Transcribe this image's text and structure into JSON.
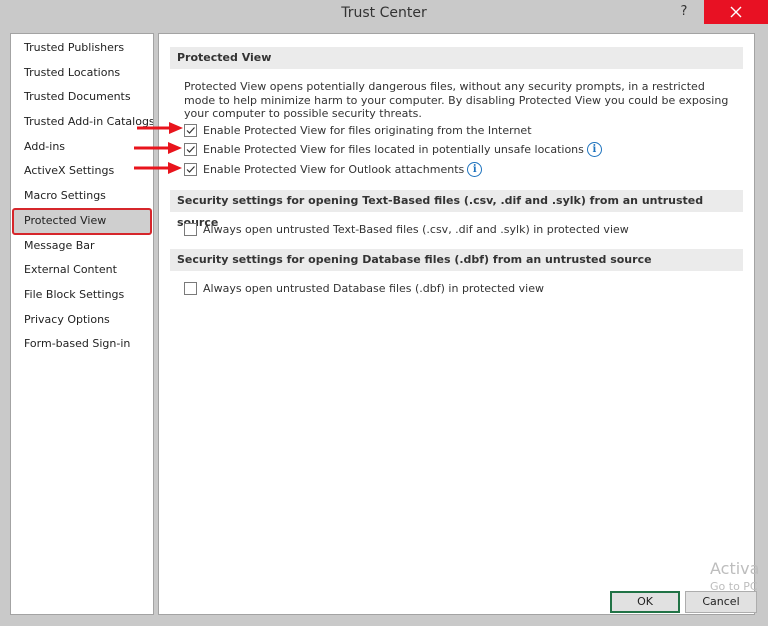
{
  "window": {
    "title": "Trust Center",
    "help_label": "?"
  },
  "sidebar": {
    "items": [
      {
        "label": "Trusted Publishers"
      },
      {
        "label": "Trusted Locations"
      },
      {
        "label": "Trusted Documents"
      },
      {
        "label": "Trusted Add-in Catalogs"
      },
      {
        "label": "Add-ins"
      },
      {
        "label": "ActiveX Settings"
      },
      {
        "label": "Macro Settings"
      },
      {
        "label": "Protected View",
        "selected": true
      },
      {
        "label": "Message Bar"
      },
      {
        "label": "External Content"
      },
      {
        "label": "File Block Settings"
      },
      {
        "label": "Privacy Options"
      },
      {
        "label": "Form-based Sign-in"
      }
    ]
  },
  "main": {
    "protected_view": {
      "header": "Protected View",
      "description": "Protected View opens potentially dangerous files, without any security prompts, in a restricted mode to help minimize harm to your computer. By disabling Protected View you could be exposing your computer to possible security threats.",
      "options": [
        {
          "label": "Enable Protected View for files originating from the Internet",
          "checked": true
        },
        {
          "label": "Enable Protected View for files located in potentially unsafe locations",
          "checked": true
        },
        {
          "label": "Enable Protected View for Outlook attachments",
          "checked": true
        }
      ]
    },
    "text_based": {
      "header": "Security settings for opening Text-Based files (.csv, .dif and .sylk) from an untrusted source",
      "option": {
        "label": "Always open untrusted Text-Based files (.csv, .dif and .sylk) in protected view",
        "checked": false
      }
    },
    "database": {
      "header": "Security settings for opening Database files (.dbf) from an untrusted source",
      "option": {
        "label": "Always open untrusted Database files (.dbf) in protected view",
        "checked": false
      }
    }
  },
  "footer": {
    "ok_label": "OK",
    "cancel_label": "Cancel"
  },
  "watermark": {
    "line1": "Activa",
    "line2": "Go to PC"
  },
  "colors": {
    "close_button": "#e81123",
    "selection_highlight": "#d6262b",
    "annotation_arrow": "#e8141c",
    "info_icon": "#1e73be",
    "ok_border": "#217346"
  }
}
